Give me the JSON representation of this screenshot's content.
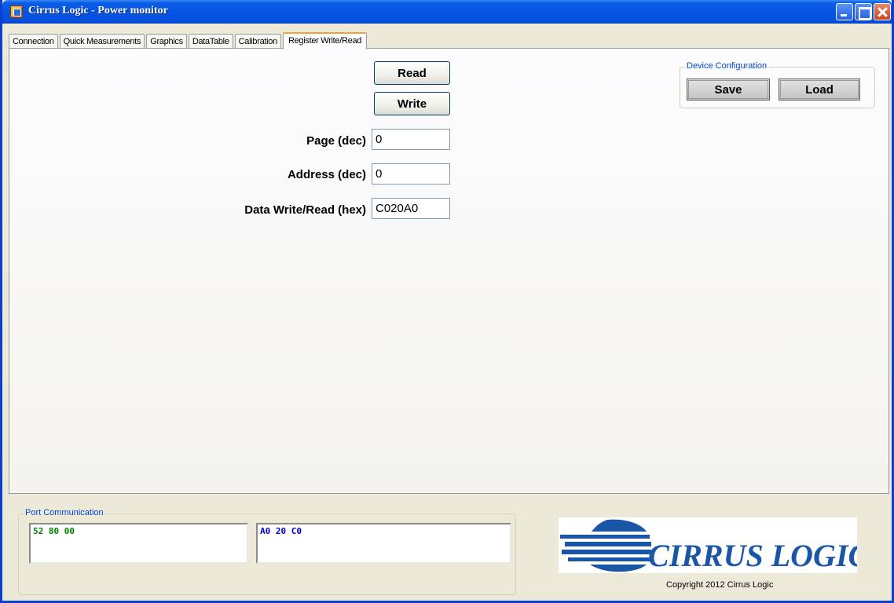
{
  "window": {
    "title": "Cirrus Logic - Power monitor"
  },
  "tabs": [
    {
      "label": "Connection"
    },
    {
      "label": "Quick Measurements"
    },
    {
      "label": "Graphics"
    },
    {
      "label": "DataTable"
    },
    {
      "label": "Calibration"
    },
    {
      "label": "Register Write/Read",
      "active": true
    }
  ],
  "register": {
    "read_label": "Read",
    "write_label": "Write",
    "page_label": "Page (dec)",
    "page_value": "0",
    "address_label": "Address (dec)",
    "address_value": "0",
    "data_label": "Data Write/Read (hex)",
    "data_value": "C020A0"
  },
  "device_config": {
    "title": "Device Configuration",
    "save_label": "Save",
    "load_label": "Load"
  },
  "port": {
    "title": "Port Communication",
    "tx": "52 80 00",
    "rx": "A0 20 C0",
    "tx_color": "#008000",
    "rx_color": "#0000cc"
  },
  "logo": {
    "text": "CIRRUS LOGIC",
    "color": "#1a56a8"
  },
  "copyright": "Copyright 2012 Cirrus Logic"
}
